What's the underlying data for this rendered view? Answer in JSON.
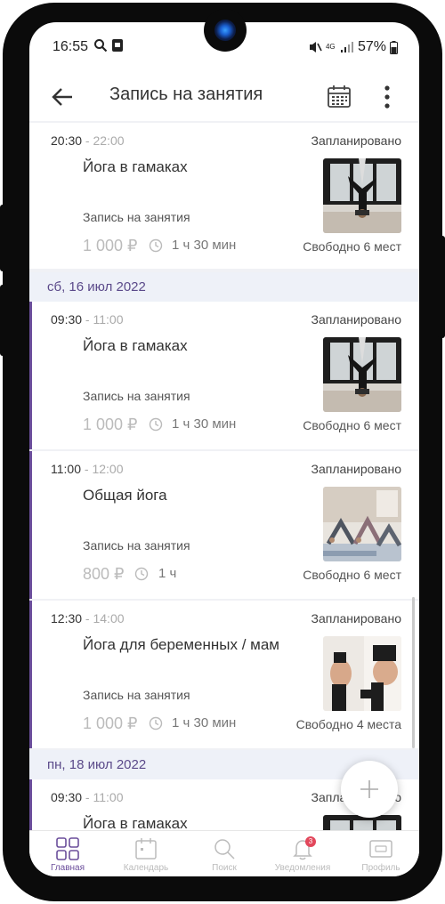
{
  "status_bar": {
    "time": "16:55",
    "network": "4G",
    "battery": "57%"
  },
  "app_bar": {
    "title": "Запись на занятия"
  },
  "date_headers": [
    "сб, 16 июл 2022",
    "пн, 18 июл 2022"
  ],
  "cards": [
    {
      "time_start": "20:30",
      "time_end": " - 22:00",
      "status": "Запланировано",
      "title": "Йога в гамаках",
      "kind": "Запись на занятия",
      "price": "1 000 ₽",
      "duration": "1 ч 30 мин",
      "free": "Свободно 6 мест",
      "image": "aerial-yoga-photo"
    },
    {
      "time_start": "09:30",
      "time_end": " - 11:00",
      "status": "Запланировано",
      "title": "Йога в гамаках",
      "kind": "Запись на занятия",
      "price": "1 000 ₽",
      "duration": "1 ч 30 мин",
      "free": "Свободно 6 мест",
      "image": "aerial-yoga-photo"
    },
    {
      "time_start": "11:00",
      "time_end": " - 12:00",
      "status": "Запланировано",
      "title": "Общая йога",
      "kind": "Запись на занятия",
      "price": "800 ₽",
      "duration": "1 ч",
      "free": "Свободно 6 мест",
      "image": "group-yoga-photo"
    },
    {
      "time_start": "12:30",
      "time_end": " - 14:00",
      "status": "Запланировано",
      "title": "Йога для беременных / мам",
      "kind": "Запись на занятия",
      "price": "1 000 ₽",
      "duration": "1 ч 30 мин",
      "free": "Свободно 4 места",
      "image": "prenatal-yoga-photo"
    },
    {
      "time_start": "09:30",
      "time_end": " - 11:00",
      "status": "Запланировано",
      "title": "Йога в гамаках",
      "image": "aerial-yoga-photo"
    }
  ],
  "bottom_nav": [
    {
      "label": "Главная",
      "icon": "grid-icon",
      "active": true
    },
    {
      "label": "Календарь",
      "icon": "calendar-icon",
      "active": false
    },
    {
      "label": "Поиск",
      "icon": "search-icon",
      "active": false
    },
    {
      "label": "Уведомления",
      "icon": "bell-icon",
      "active": false,
      "badge": "3"
    },
    {
      "label": "Профиль",
      "icon": "profile-card-icon",
      "active": false
    }
  ],
  "colors": {
    "accent": "#6b4e9b",
    "date_header_bg": "#eef1f8",
    "badge": "#e2475b"
  }
}
